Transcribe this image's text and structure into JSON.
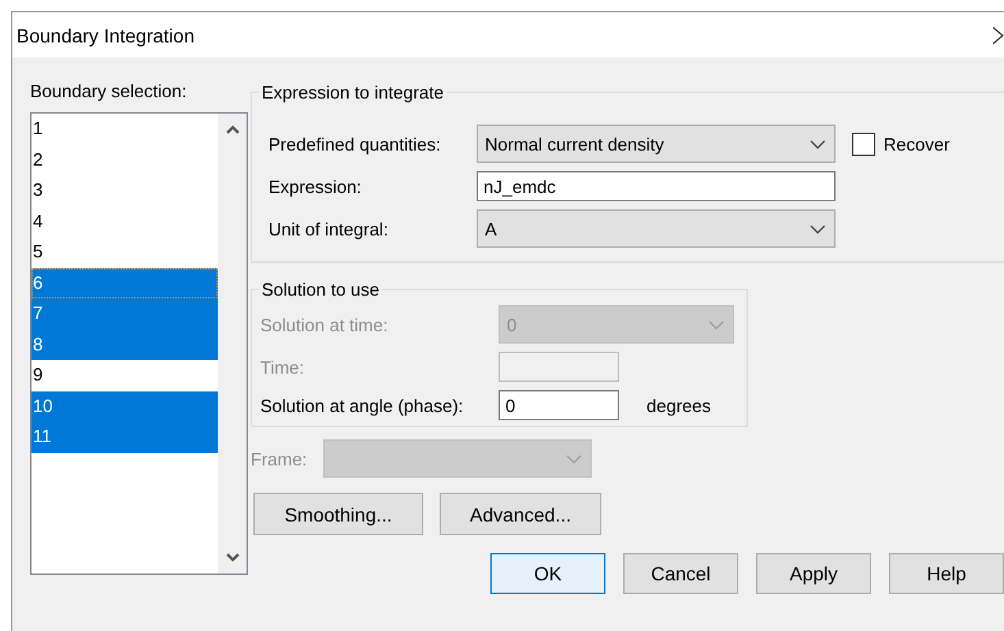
{
  "window": {
    "title": "Boundary Integration"
  },
  "boundary_selection": {
    "label": "Boundary selection:",
    "items": [
      {
        "label": "1",
        "selected": false,
        "focused": false
      },
      {
        "label": "2",
        "selected": false,
        "focused": false
      },
      {
        "label": "3",
        "selected": false,
        "focused": false
      },
      {
        "label": "4",
        "selected": false,
        "focused": false
      },
      {
        "label": "5",
        "selected": false,
        "focused": false
      },
      {
        "label": "6",
        "selected": true,
        "focused": true
      },
      {
        "label": "7",
        "selected": true,
        "focused": false
      },
      {
        "label": "8",
        "selected": true,
        "focused": false
      },
      {
        "label": "9",
        "selected": false,
        "focused": false
      },
      {
        "label": "10",
        "selected": true,
        "focused": false
      },
      {
        "label": "11",
        "selected": true,
        "focused": false
      }
    ]
  },
  "expression_group": {
    "title": "Expression to integrate",
    "predefined": {
      "label": "Predefined quantities:",
      "value": "Normal current density"
    },
    "recover": {
      "label": "Recover",
      "checked": false
    },
    "expression": {
      "label": "Expression:",
      "value": "nJ_emdc"
    },
    "unit": {
      "label": "Unit of integral:",
      "value": "A"
    }
  },
  "solution_group": {
    "title": "Solution to use",
    "rows": [
      {
        "kind": "combo",
        "label": "Solution at time:",
        "value": "0",
        "disabled": true
      },
      {
        "kind": "field",
        "label": "Time:",
        "disabled": true
      },
      {
        "kind": "field",
        "label": "Solution at angle (phase):",
        "value": "0",
        "disabled": false,
        "unit": "degrees"
      }
    ]
  },
  "frame": {
    "label": "Frame:",
    "disabled": true
  },
  "buttons": [
    {
      "label": "Smoothing..."
    },
    {
      "label": "Advanced..."
    }
  ],
  "dialog_buttons": [
    {
      "label": "OK",
      "default": true
    },
    {
      "label": "Cancel",
      "default": false
    },
    {
      "label": "Apply",
      "default": false
    },
    {
      "label": "Help",
      "default": false
    }
  ]
}
